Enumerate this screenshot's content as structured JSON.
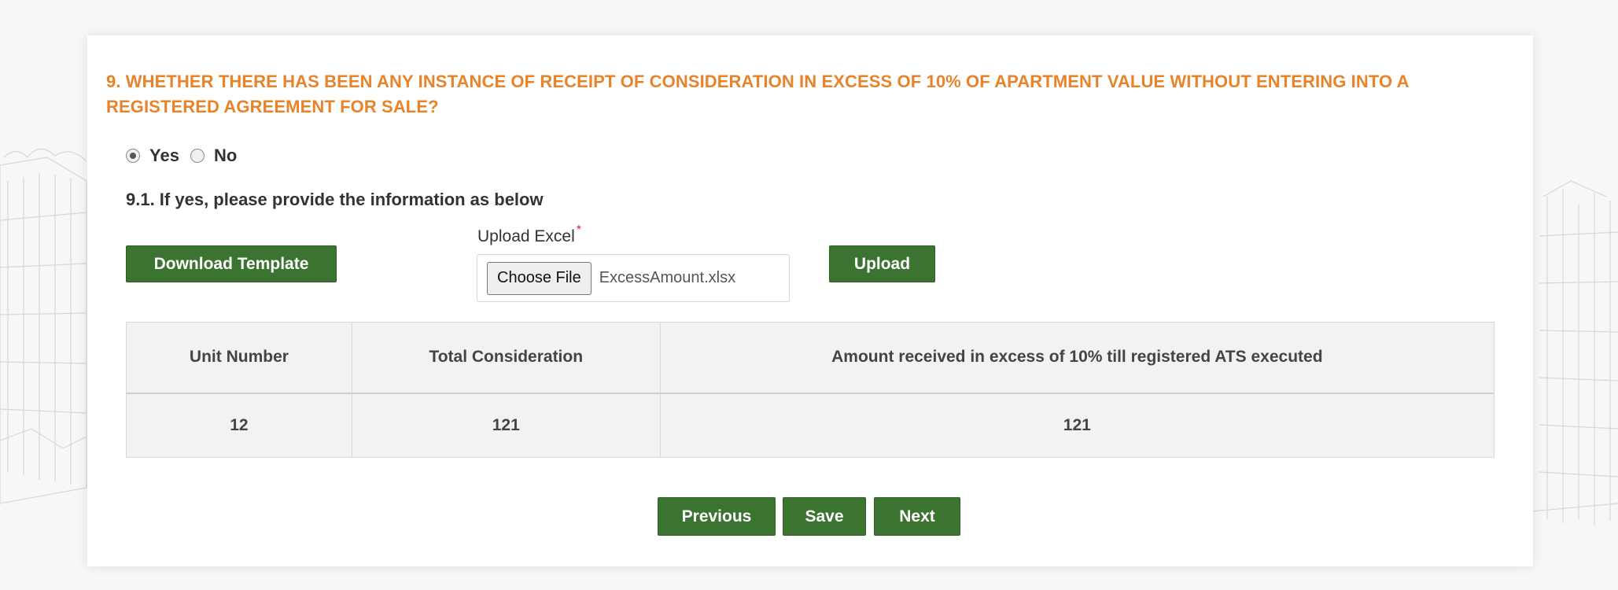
{
  "question": {
    "text": "9. WHETHER THERE HAS BEEN ANY INSTANCE OF RECEIPT OF CONSIDERATION IN EXCESS OF 10% OF APARTMENT VALUE WITHOUT ENTERING INTO A REGISTERED AGREEMENT FOR SALE?"
  },
  "radio": {
    "yes_label": "Yes",
    "no_label": "No",
    "selected": "Yes"
  },
  "sub_question": "9.1. If yes, please provide the information as below",
  "actions": {
    "download_template": "Download Template",
    "upload_label": "Upload Excel",
    "required_marker": "*",
    "choose_file": "Choose File",
    "file_name": "ExcessAmount.xlsx",
    "upload": "Upload"
  },
  "table": {
    "headers": [
      "Unit Number",
      "Total Consideration",
      "Amount received in excess of 10% till registered ATS executed"
    ],
    "rows": [
      [
        "12",
        "121",
        "121"
      ]
    ]
  },
  "nav": {
    "previous": "Previous",
    "save": "Save",
    "next": "Next"
  },
  "colors": {
    "accent_orange": "#e8832a",
    "button_green": "#3b7330"
  }
}
